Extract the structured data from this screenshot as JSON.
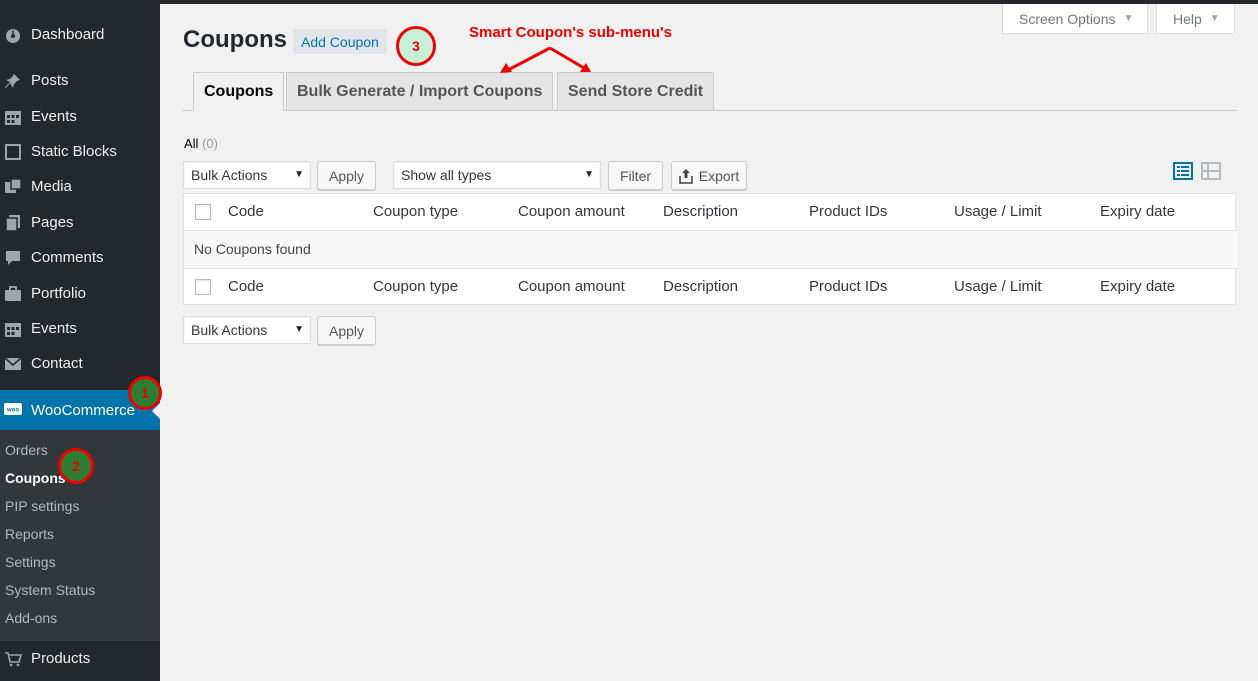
{
  "sidebar": {
    "items": [
      {
        "label": "Dashboard",
        "icon": "dashboard-icon"
      },
      {
        "label": "Posts",
        "icon": "pushpin-icon"
      },
      {
        "label": "Events",
        "icon": "calendar-icon"
      },
      {
        "label": "Static Blocks",
        "icon": "square-icon"
      },
      {
        "label": "Media",
        "icon": "media-icon"
      },
      {
        "label": "Pages",
        "icon": "pages-icon"
      },
      {
        "label": "Comments",
        "icon": "comment-icon"
      },
      {
        "label": "Portfolio",
        "icon": "briefcase-icon"
      },
      {
        "label": "Events",
        "icon": "calendar-icon"
      },
      {
        "label": "Contact",
        "icon": "envelope-icon"
      },
      {
        "label": "WooCommerce",
        "icon": "woo-icon"
      },
      {
        "label": "Products",
        "icon": "cart-icon"
      }
    ],
    "submenu": [
      "Orders",
      "Coupons",
      "PIP settings",
      "Reports",
      "Settings",
      "System Status",
      "Add-ons"
    ]
  },
  "header": {
    "title": "Coupons",
    "add_label": "Add Coupon",
    "screen_options": "Screen Options",
    "help": "Help"
  },
  "annotations": {
    "callout_1": "1",
    "callout_2": "2",
    "callout_3": "3",
    "note": "Smart Coupon's sub-menu's",
    "color": "#e00000"
  },
  "tabs": [
    "Coupons",
    "Bulk Generate / Import Coupons",
    "Send Store Credit"
  ],
  "filter": {
    "all_label": "All",
    "all_count": "(0)",
    "bulk_actions": "Bulk Actions",
    "apply": "Apply",
    "type_select": "Show all types",
    "filter_btn": "Filter",
    "export_btn": "Export"
  },
  "table": {
    "columns": [
      "Code",
      "Coupon type",
      "Coupon amount",
      "Description",
      "Product IDs",
      "Usage / Limit",
      "Expiry date"
    ],
    "empty_message": "No Coupons found"
  },
  "colors": {
    "sidebar_bg": "#23282d",
    "active_bg": "#0073aa",
    "link": "#0073aa"
  }
}
